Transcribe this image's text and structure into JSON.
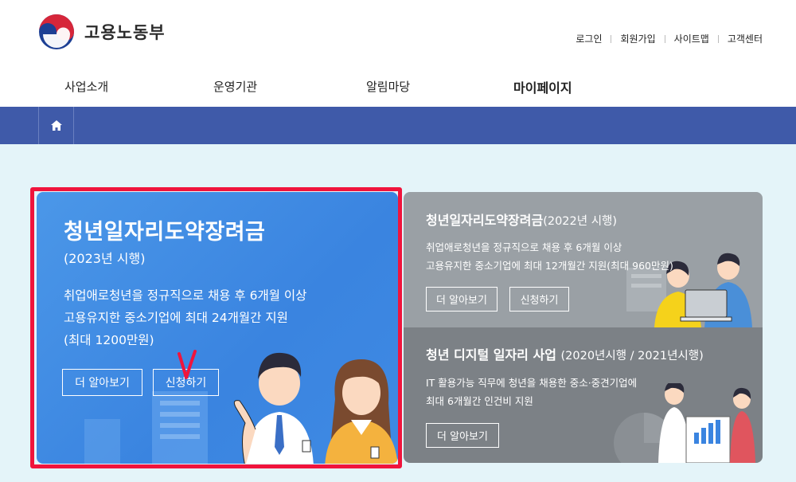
{
  "header": {
    "logo_text": "고용노동부",
    "util_links": [
      "로그인",
      "회원가입",
      "사이트맵",
      "고객센터"
    ]
  },
  "gnb": {
    "items": [
      "사업소개",
      "운영기관",
      "알림마당",
      "마이페이지"
    ]
  },
  "main_card": {
    "title": "청년일자리도약장려금",
    "subtitle": "(2023년 시행)",
    "desc": [
      "취업애로청년을 정규직으로 채용 후 6개월 이상",
      "고용유지한 중소기업에 최대 24개월간 지원",
      "(최대 1200만원)"
    ],
    "btn_more": "더 알아보기",
    "btn_apply": "신청하기"
  },
  "card2": {
    "title": "청년일자리도약장려금",
    "title_suffix": "(2022년 시행)",
    "desc": [
      "취업애로청년을 정규직으로 채용 후 6개월 이상",
      "고용유지한 중소기업에 최대 12개월간 지원(최대 960만원)"
    ],
    "btn_more": "더 알아보기",
    "btn_apply": "신청하기"
  },
  "card3": {
    "title": "청년 디지털 일자리 사업",
    "title_suffix": "(2020년시행 / 2021년시행)",
    "desc": [
      "IT 활용가능 직무에 청년을 채용한 중소·중견기업에",
      "최대 6개월간 인건비 지원"
    ],
    "btn_more": "더 알아보기"
  },
  "colors": {
    "nav_bar": "#3f5aa9",
    "main_card": "#3a84e0",
    "card2": "#9aa0a5",
    "card3": "#7c8186",
    "highlight": "#f0143c",
    "page_bg": "#e4f4f9"
  },
  "icons": {
    "logo": "taegeuk-logo-icon",
    "home": "home-icon"
  }
}
